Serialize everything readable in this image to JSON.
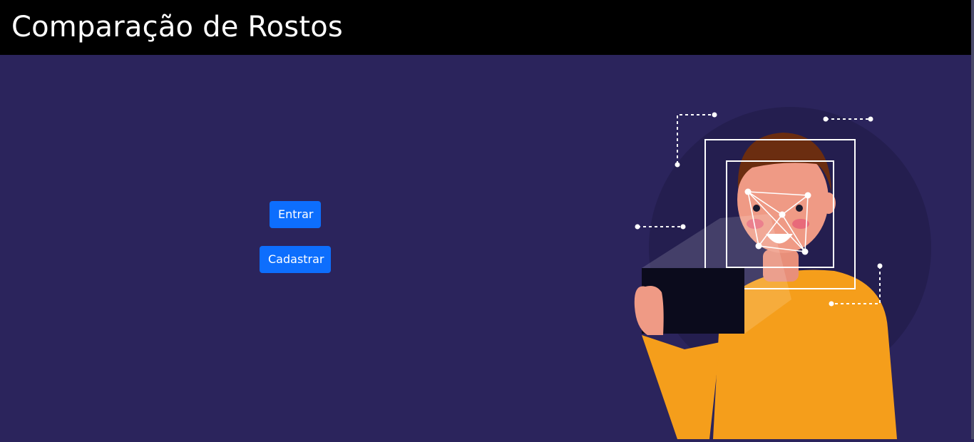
{
  "header": {
    "title": "Comparação de Rostos"
  },
  "actions": {
    "login_label": "Entrar",
    "register_label": "Cadastrar"
  },
  "illustration": {
    "icon": "face-recognition-illustration"
  },
  "colors": {
    "header_bg": "#000000",
    "page_bg": "#2b245c",
    "button_bg": "#0d6efd",
    "shirt": "#f59e1b",
    "skin": "#ef9a85",
    "hair": "#6b2d10"
  }
}
